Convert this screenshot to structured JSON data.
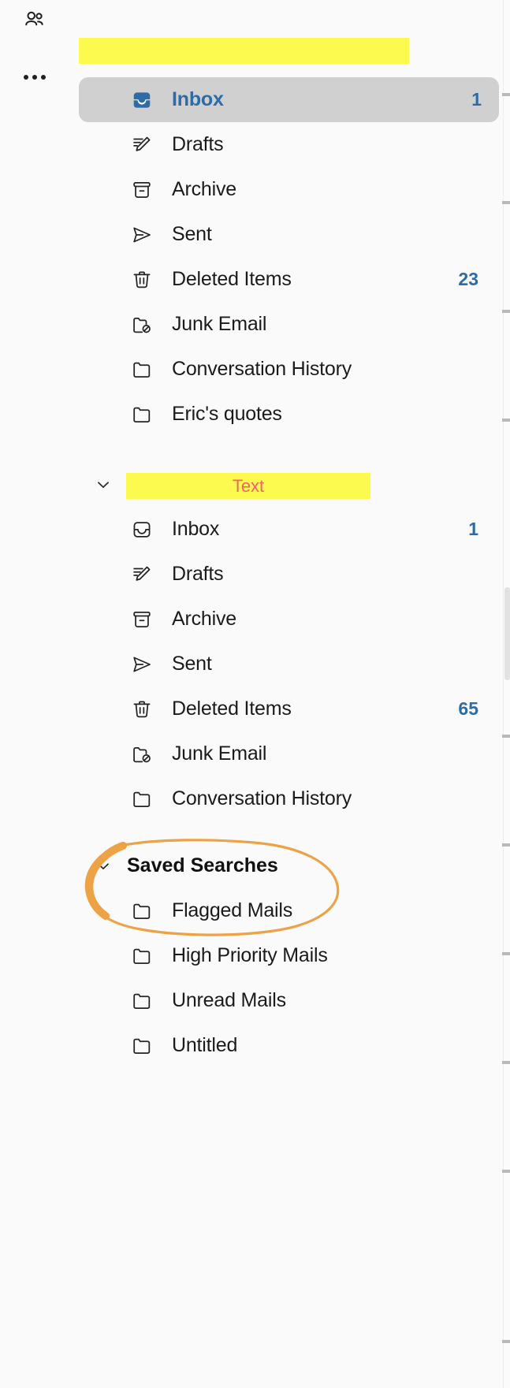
{
  "rail": {
    "people_icon": "people-icon",
    "more_icon": "more-options-icon"
  },
  "accounts": [
    {
      "name_redacted": true,
      "redaction_text": "",
      "folders": [
        {
          "icon": "inbox-filled-icon",
          "label": "Inbox",
          "count": "1",
          "selected": true
        },
        {
          "icon": "drafts-pencil-icon",
          "label": "Drafts",
          "count": "",
          "selected": false
        },
        {
          "icon": "archive-box-icon",
          "label": "Archive",
          "count": "",
          "selected": false
        },
        {
          "icon": "sent-paper-plane-icon",
          "label": "Sent",
          "count": "",
          "selected": false
        },
        {
          "icon": "trash-bin-icon",
          "label": "Deleted Items",
          "count": "23",
          "selected": false
        },
        {
          "icon": "junk-folder-blocked-icon",
          "label": "Junk Email",
          "count": "",
          "selected": false
        },
        {
          "icon": "folder-icon",
          "label": "Conversation History",
          "count": "",
          "selected": false
        },
        {
          "icon": "folder-icon",
          "label": "Eric's quotes",
          "count": "",
          "selected": false
        }
      ]
    },
    {
      "name_redacted": true,
      "redaction_text": "Text",
      "chevron": "chevron-down-icon",
      "folders": [
        {
          "icon": "inbox-outline-icon",
          "label": "Inbox",
          "count": "1",
          "selected": false
        },
        {
          "icon": "drafts-pencil-icon",
          "label": "Drafts",
          "count": "",
          "selected": false
        },
        {
          "icon": "archive-box-icon",
          "label": "Archive",
          "count": "",
          "selected": false
        },
        {
          "icon": "sent-paper-plane-icon",
          "label": "Sent",
          "count": "",
          "selected": false
        },
        {
          "icon": "trash-bin-icon",
          "label": "Deleted Items",
          "count": "65",
          "selected": false
        },
        {
          "icon": "junk-folder-blocked-icon",
          "label": "Junk Email",
          "count": "",
          "selected": false
        },
        {
          "icon": "folder-icon",
          "label": "Conversation History",
          "count": "",
          "selected": false
        }
      ]
    }
  ],
  "saved_searches": {
    "chevron": "chevron-down-icon",
    "title": "Saved Searches",
    "annotation_color": "#eda246",
    "items": [
      {
        "icon": "folder-icon",
        "label": "Flagged Mails",
        "count": ""
      },
      {
        "icon": "folder-icon",
        "label": "High Priority Mails",
        "count": ""
      },
      {
        "icon": "folder-icon",
        "label": "Unread Mails",
        "count": ""
      },
      {
        "icon": "folder-icon",
        "label": "Untitled",
        "count": ""
      }
    ]
  },
  "colors": {
    "accent_blue": "#2f6ba5",
    "selected_bg": "#d0d0d0",
    "highlight_yellow": "#fcf94f",
    "highlight_text_red": "#f1636a",
    "annotation_orange": "#eda246",
    "pane_bg": "#fafafa"
  }
}
